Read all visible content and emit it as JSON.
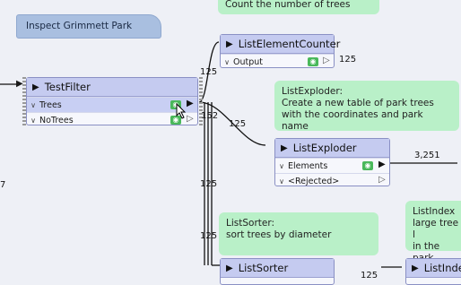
{
  "bookmark": {
    "label": "Inspect Grimmett Park"
  },
  "notes": {
    "count": "Count the number of trees",
    "exploder": [
      "ListExploder:",
      "Create a new table of park trees",
      "with the coordinates and park name"
    ],
    "sorter": [
      "ListSorter:",
      "sort trees by diameter"
    ],
    "indexer": [
      "ListIndex",
      "large tree l",
      "in the park"
    ]
  },
  "transformers": {
    "testfilter": {
      "name": "TestFilter",
      "ports": [
        "Trees",
        "NoTrees"
      ]
    },
    "counter": {
      "name": "ListElementCounter",
      "ports": [
        "Output"
      ]
    },
    "exploder": {
      "name": "ListExploder",
      "ports": [
        "Elements",
        "<Rejected>"
      ]
    },
    "sorter": {
      "name": "ListSorter"
    },
    "indexer": {
      "name": "ListIndex"
    }
  },
  "counts": {
    "edge_left": "7",
    "tf_to_counter": "125",
    "counter_out": "125",
    "tf_to_exploder": "125",
    "notrees": "152",
    "vert_a": "125",
    "vert_b": "125",
    "exploder_out": "3,251",
    "indexer_in": "125"
  },
  "colors": {
    "canvas": "#eef0f6",
    "note": "#b9f0c8",
    "header": "#c5cbf0",
    "accent": "#49b85a"
  }
}
